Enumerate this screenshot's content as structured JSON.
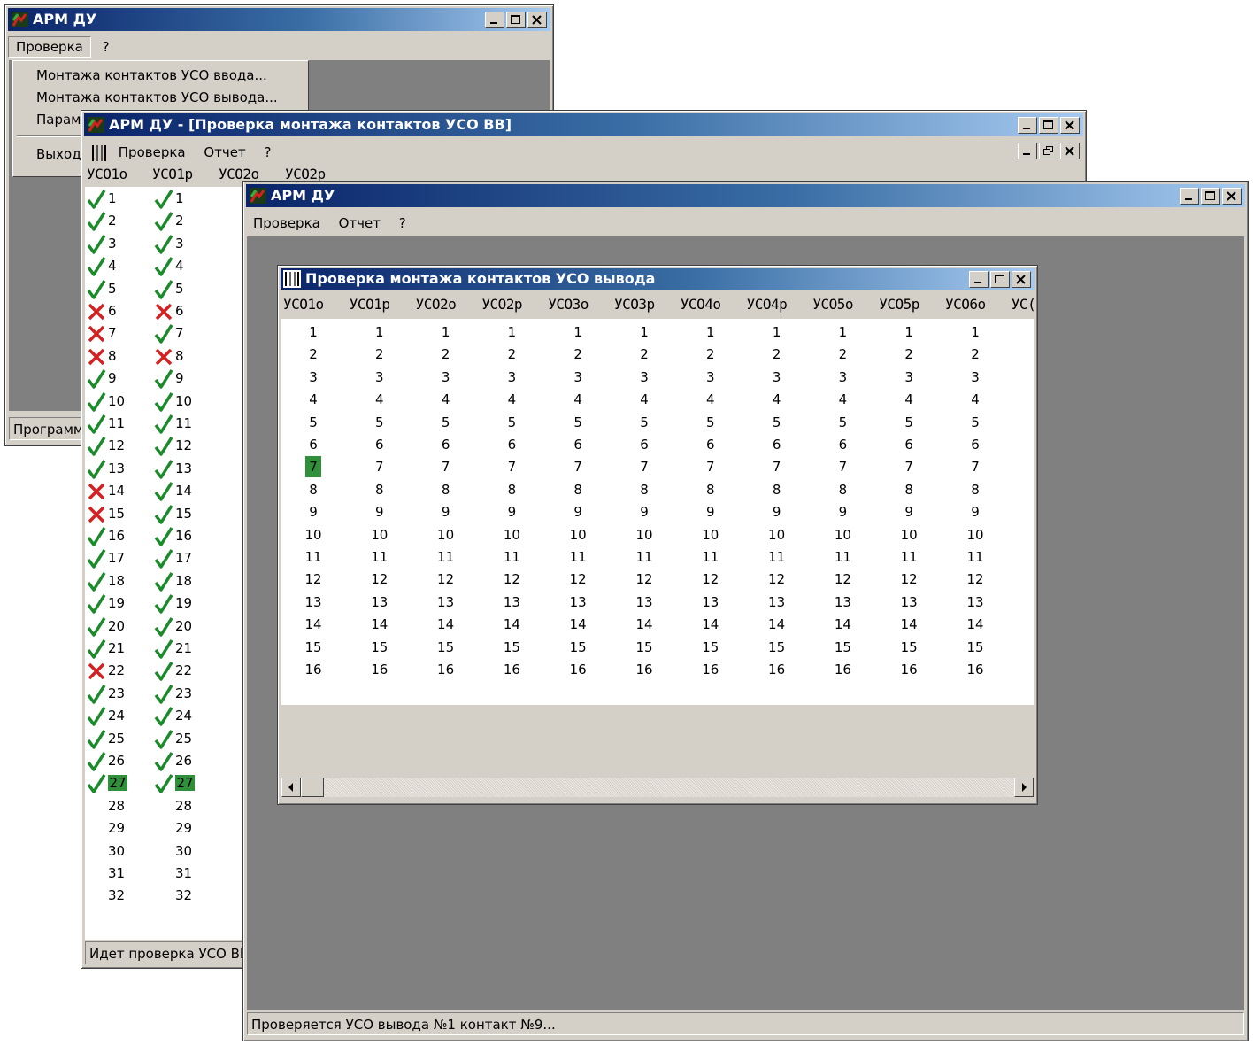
{
  "win_back": {
    "title": "АРМ ДУ",
    "menu": [
      "Проверка",
      "?"
    ],
    "dropdown": [
      "Монтажа контактов УСО ввода...",
      "Монтажа контактов УСО вывода...",
      "Параме",
      "Выход"
    ],
    "status": "Программа"
  },
  "win_mid": {
    "title": "АРМ ДУ - [Проверка монтажа контактов УСО ВВ]",
    "menu": [
      "Проверка",
      "Отчет",
      "?"
    ],
    "columns": [
      "УСО1о",
      "УСО1р",
      "УСО2о",
      "УСО2р"
    ],
    "col1_marks": [
      "ok",
      "ok",
      "ok",
      "ok",
      "ok",
      "fail",
      "fail",
      "fail",
      "ok",
      "ok",
      "ok",
      "ok",
      "ok",
      "fail",
      "fail",
      "ok",
      "ok",
      "ok",
      "ok",
      "ok",
      "ok",
      "fail",
      "ok",
      "ok",
      "ok",
      "ok",
      "ok"
    ],
    "col2_marks": [
      "ok",
      "ok",
      "ok",
      "ok",
      "ok",
      "fail",
      "ok",
      "fail",
      "ok",
      "ok",
      "ok",
      "ok",
      "ok",
      "ok",
      "ok",
      "ok",
      "ok",
      "ok",
      "ok",
      "ok",
      "ok",
      "ok",
      "ok",
      "ok",
      "ok",
      "ok",
      "ok"
    ],
    "contacts": [
      "1",
      "2",
      "3",
      "4",
      "5",
      "6",
      "7",
      "8",
      "9",
      "10",
      "11",
      "12",
      "13",
      "14",
      "15",
      "16",
      "17",
      "18",
      "19",
      "20",
      "21",
      "22",
      "23",
      "24",
      "25",
      "26",
      "27",
      "28",
      "29",
      "30",
      "31",
      "32"
    ],
    "current_contact_index": 26,
    "status": "Идет проверка УСО ВВ"
  },
  "win_front": {
    "title": "АРМ ДУ",
    "menu": [
      "Проверка",
      "Отчет",
      "?"
    ],
    "status": "Проверяется УСО вывода №1 контакт №9..."
  },
  "child": {
    "title": "Проверка монтажа контактов УСО вывода",
    "columns": [
      "УСО1о",
      "УСО1р",
      "УСО2о",
      "УСО2р",
      "УСО3о",
      "УСО3р",
      "УСО4о",
      "УСО4р",
      "УСО5о",
      "УСО5р",
      "УСО6о",
      "УС("
    ],
    "rows": [
      "1",
      "2",
      "3",
      "4",
      "5",
      "6",
      "7",
      "8",
      "9",
      "10",
      "11",
      "12",
      "13",
      "14",
      "15",
      "16"
    ],
    "highlight": {
      "col": 0,
      "row": 6
    },
    "highlight_color": "#2f8f3a"
  },
  "colors": {
    "ok": "#1a8a2a",
    "fail": "#d42020",
    "title_start": "#0a246a",
    "title_end": "#a6caf0",
    "mdi": "#808080"
  },
  "icons": [
    "app-logo-icon",
    "minimize-icon",
    "maximize-icon",
    "restore-icon",
    "close-icon",
    "grid-icon",
    "check-icon",
    "cross-icon",
    "arrow-left-icon",
    "arrow-right-icon"
  ]
}
